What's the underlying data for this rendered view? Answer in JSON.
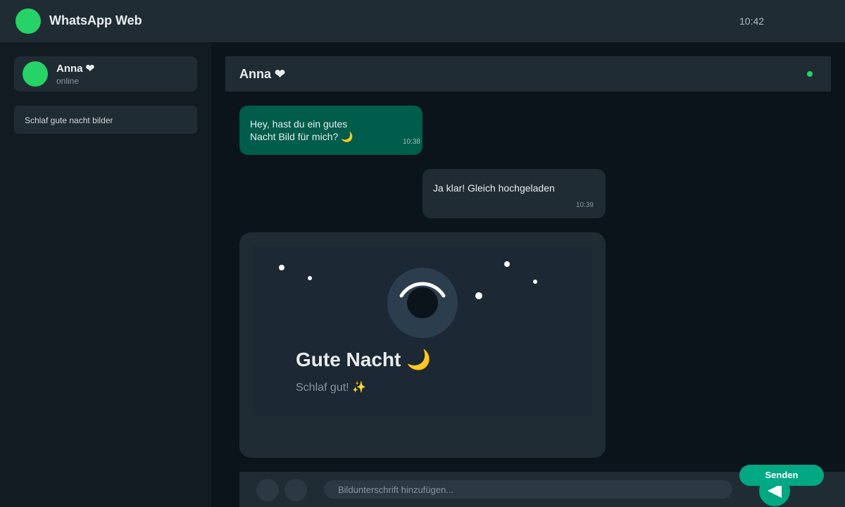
{
  "app": {
    "title": "WhatsApp Web",
    "time": "10:42"
  },
  "sidebar": {
    "chats": [
      {
        "name": "Anna ❤",
        "status": "online"
      }
    ],
    "search_chip": "Schlaf gute nacht bilder"
  },
  "chat": {
    "name": "Anna ❤",
    "messages": [
      {
        "text_line1": "Hey, hast du ein gutes",
        "text_line2": "Nacht Bild für mich? 🌙",
        "time": "10:38"
      },
      {
        "text": "Ja klar! Gleich hochgeladen",
        "time": "10:39"
      }
    ],
    "image": {
      "title": "Gute Nacht 🌙",
      "subtitle": "Schlaf gut! ✨"
    }
  },
  "composer": {
    "placeholder": "Bildunterschrift hinzufügen...",
    "send_label": "Senden"
  },
  "colors": {
    "accent": "#25d366",
    "send": "#00a884",
    "incoming_bubble": "#005c4b",
    "panel": "#202c33",
    "background": "#0b141a"
  },
  "icons": {
    "send": "send-arrow-icon",
    "logo": "whatsapp-logo-icon"
  }
}
